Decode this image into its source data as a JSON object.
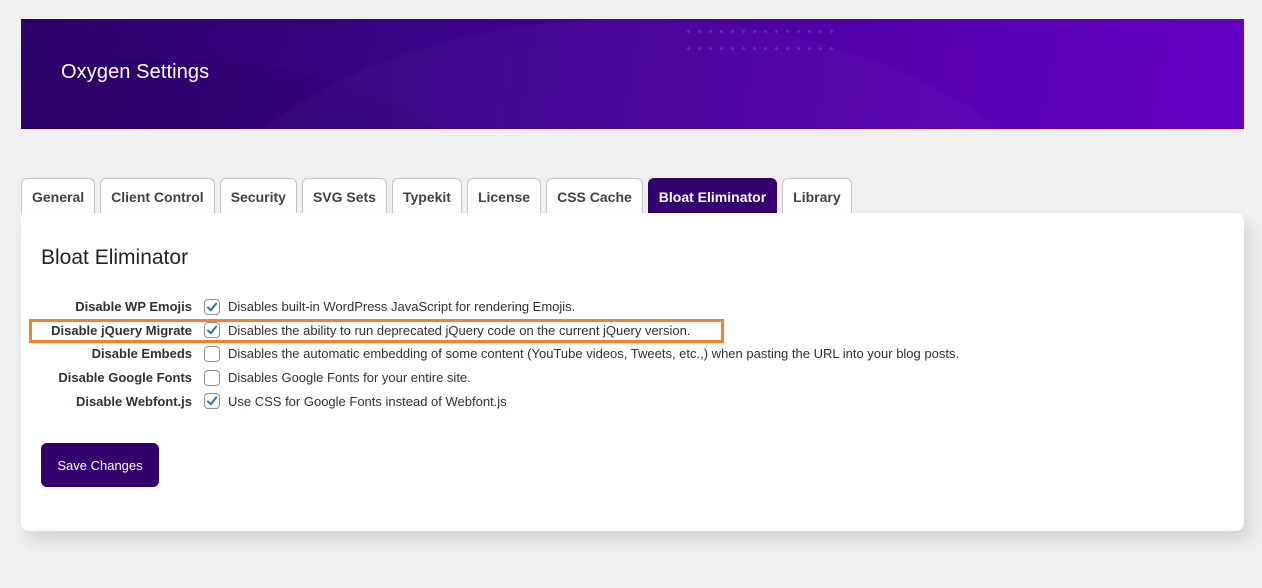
{
  "header": {
    "title": "Oxygen Settings"
  },
  "tabs": [
    {
      "label": "General",
      "active": false
    },
    {
      "label": "Client Control",
      "active": false
    },
    {
      "label": "Security",
      "active": false
    },
    {
      "label": "SVG Sets",
      "active": false
    },
    {
      "label": "Typekit",
      "active": false
    },
    {
      "label": "License",
      "active": false
    },
    {
      "label": "CSS Cache",
      "active": false
    },
    {
      "label": "Bloat Eliminator",
      "active": true
    },
    {
      "label": "Library",
      "active": false
    }
  ],
  "panel": {
    "title": "Bloat Eliminator",
    "settings": [
      {
        "label": "Disable WP Emojis",
        "checked": true,
        "description": "Disables built-in WordPress JavaScript for rendering Emojis.",
        "highlighted": false
      },
      {
        "label": "Disable jQuery Migrate",
        "checked": true,
        "description": "Disables the ability to run deprecated jQuery code on the current jQuery version.",
        "highlighted": true
      },
      {
        "label": "Disable Embeds",
        "checked": false,
        "description": "Disables the automatic embedding of some content (YouTube videos, Tweets, etc.,) when pasting the URL into your blog posts.",
        "highlighted": false
      },
      {
        "label": "Disable Google Fonts",
        "checked": false,
        "description": "Disables Google Fonts for your entire site.",
        "highlighted": false
      },
      {
        "label": "Disable Webfont.js",
        "checked": true,
        "description": "Use CSS for Google Fonts instead of Webfont.js",
        "highlighted": false
      }
    ],
    "save_label": "Save Changes"
  },
  "colors": {
    "brand": "#33006e",
    "highlight": "#f57f2a",
    "checkmark": "#2271b1"
  }
}
